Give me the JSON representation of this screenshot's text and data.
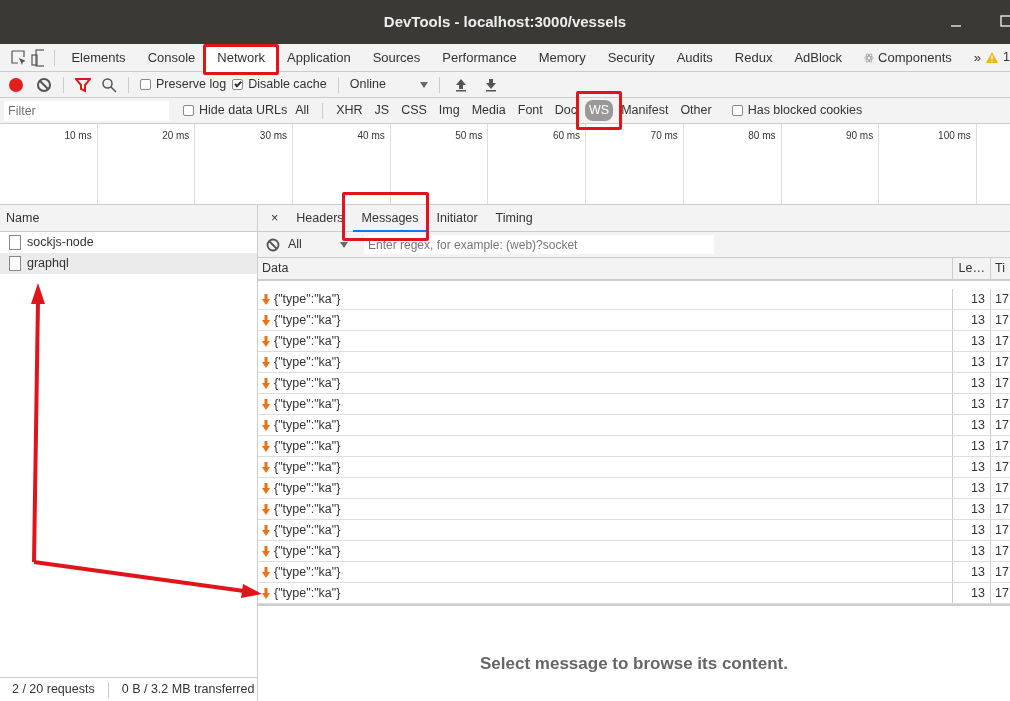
{
  "window": {
    "title": "DevTools - localhost:3000/vessels"
  },
  "panel_tabs": [
    {
      "label": "Elements",
      "selected": false,
      "highlighted": false,
      "kind": "plain"
    },
    {
      "label": "Console",
      "selected": false,
      "highlighted": false,
      "kind": "plain"
    },
    {
      "label": "Network",
      "selected": true,
      "highlighted": true,
      "kind": "plain"
    },
    {
      "label": "Application",
      "selected": false,
      "highlighted": false,
      "kind": "plain"
    },
    {
      "label": "Sources",
      "selected": false,
      "highlighted": false,
      "kind": "plain"
    },
    {
      "label": "Performance",
      "selected": false,
      "highlighted": false,
      "kind": "plain"
    },
    {
      "label": "Memory",
      "selected": false,
      "highlighted": false,
      "kind": "plain"
    },
    {
      "label": "Security",
      "selected": false,
      "highlighted": false,
      "kind": "plain"
    },
    {
      "label": "Audits",
      "selected": false,
      "highlighted": false,
      "kind": "plain"
    },
    {
      "label": "Redux",
      "selected": false,
      "highlighted": false,
      "kind": "plain"
    },
    {
      "label": "AdBlock",
      "selected": false,
      "highlighted": false,
      "kind": "plain"
    },
    {
      "label": "Components",
      "selected": false,
      "highlighted": false,
      "kind": "react"
    }
  ],
  "more_tabs": "»",
  "warning_count": "1",
  "toolbar": {
    "recording": true,
    "preserve_log": {
      "label": "Preserve log",
      "checked": false
    },
    "disable_cache": {
      "label": "Disable cache",
      "checked": true
    },
    "throttling": "Online"
  },
  "filter_bar": {
    "placeholder": "Filter",
    "hide_data_urls": {
      "label": "Hide data URLs",
      "checked": false
    },
    "types": [
      {
        "label": "All",
        "selected": false,
        "highlighted": false
      },
      {
        "label": "XHR",
        "selected": false,
        "highlighted": false
      },
      {
        "label": "JS",
        "selected": false,
        "highlighted": false
      },
      {
        "label": "CSS",
        "selected": false,
        "highlighted": false
      },
      {
        "label": "Img",
        "selected": false,
        "highlighted": false
      },
      {
        "label": "Media",
        "selected": false,
        "highlighted": false
      },
      {
        "label": "Font",
        "selected": false,
        "highlighted": false
      },
      {
        "label": "Doc",
        "selected": false,
        "highlighted": false
      },
      {
        "label": "WS",
        "selected": true,
        "highlighted": true
      },
      {
        "label": "Manifest",
        "selected": false,
        "highlighted": false
      },
      {
        "label": "Other",
        "selected": false,
        "highlighted": false
      }
    ],
    "has_blocked_cookies": {
      "label": "Has blocked cookies",
      "checked": false
    }
  },
  "timeline": {
    "ticks": [
      "10 ms",
      "20 ms",
      "30 ms",
      "40 ms",
      "50 ms",
      "60 ms",
      "70 ms",
      "80 ms",
      "90 ms",
      "100 ms"
    ]
  },
  "requests": {
    "column": "Name",
    "items": [
      {
        "name": "sockjs-node",
        "selected": false
      },
      {
        "name": "graphql",
        "selected": true
      }
    ]
  },
  "status_bar": [
    "2 / 20 requests",
    "0 B / 3.2 MB transferred"
  ],
  "detail_close": "×",
  "detail_tabs": [
    {
      "label": "Headers",
      "selected": false,
      "highlighted": false
    },
    {
      "label": "Messages",
      "selected": true,
      "highlighted": true
    },
    {
      "label": "Initiator",
      "selected": false,
      "highlighted": false
    },
    {
      "label": "Timing",
      "selected": false,
      "highlighted": false
    }
  ],
  "messages": {
    "filter": "All",
    "placeholder": "Enter regex, for example: (web)?socket",
    "columns": [
      "Data",
      "Le…",
      "Ti"
    ],
    "rows": [
      {
        "kind": "received",
        "data": "{\"type\":\"ka\"}",
        "length": "13",
        "time": "17"
      },
      {
        "kind": "received",
        "data": "{\"type\":\"ka\"}",
        "length": "13",
        "time": "17"
      },
      {
        "kind": "received",
        "data": "{\"type\":\"ka\"}",
        "length": "13",
        "time": "17"
      },
      {
        "kind": "received",
        "data": "{\"type\":\"ka\"}",
        "length": "13",
        "time": "17"
      },
      {
        "kind": "received",
        "data": "{\"type\":\"ka\"}",
        "length": "13",
        "time": "17"
      },
      {
        "kind": "received",
        "data": "{\"type\":\"ka\"}",
        "length": "13",
        "time": "17"
      },
      {
        "kind": "received",
        "data": "{\"type\":\"ka\"}",
        "length": "13",
        "time": "17"
      },
      {
        "kind": "received",
        "data": "{\"type\":\"ka\"}",
        "length": "13",
        "time": "17"
      },
      {
        "kind": "received",
        "data": "{\"type\":\"ka\"}",
        "length": "13",
        "time": "17"
      },
      {
        "kind": "received",
        "data": "{\"type\":\"ka\"}",
        "length": "13",
        "time": "17"
      },
      {
        "kind": "received",
        "data": "{\"type\":\"ka\"}",
        "length": "13",
        "time": "17"
      },
      {
        "kind": "received",
        "data": "{\"type\":\"ka\"}",
        "length": "13",
        "time": "17"
      },
      {
        "kind": "received",
        "data": "{\"type\":\"ka\"}",
        "length": "13",
        "time": "17"
      },
      {
        "kind": "received",
        "data": "{\"type\":\"ka\"}",
        "length": "13",
        "time": "17"
      },
      {
        "kind": "received",
        "data": "{\"type\":\"ka\"}",
        "length": "13",
        "time": "17"
      }
    ]
  },
  "empty_message": "Select message to browse its content."
}
